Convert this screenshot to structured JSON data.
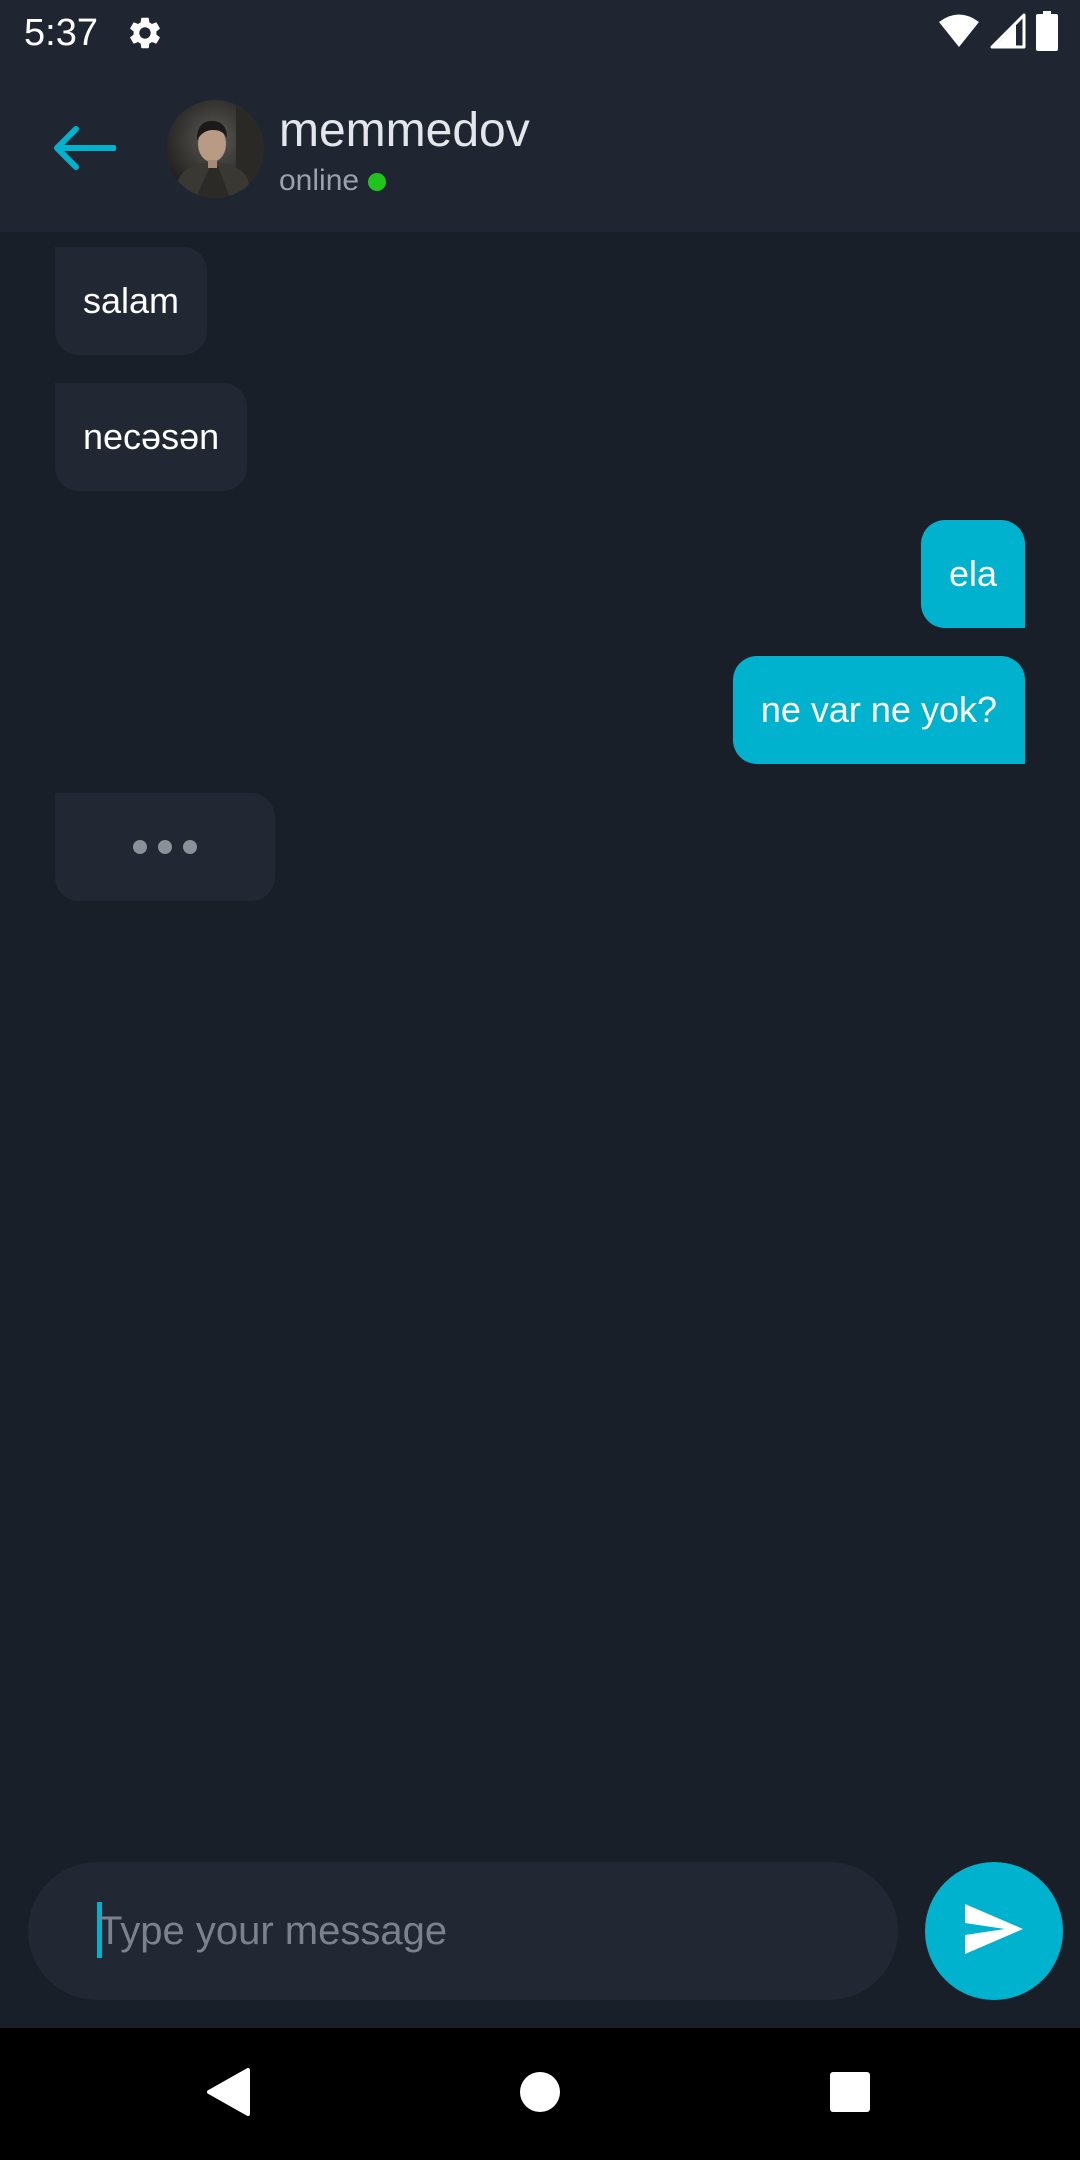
{
  "status_bar": {
    "time": "5:37",
    "icons": [
      "gear-icon",
      "wifi-icon",
      "signal-icon",
      "battery-icon"
    ]
  },
  "header": {
    "back_icon": "arrow-left-icon",
    "contact_name": "memmedov",
    "presence": "online",
    "presence_color": "#22c31c"
  },
  "messages": [
    {
      "direction": "incoming",
      "text": "salam"
    },
    {
      "direction": "incoming",
      "text": "necəsən"
    },
    {
      "direction": "outgoing",
      "text": "ela"
    },
    {
      "direction": "outgoing",
      "text": "ne var ne yok?"
    }
  ],
  "typing_indicator": {
    "icon": "typing-dots-icon"
  },
  "composer": {
    "placeholder": "Type your message",
    "value": "",
    "send_icon": "send-icon"
  },
  "colors": {
    "accent": "#00b2cd",
    "background": "#191f29",
    "header_background": "#202631",
    "incoming_bubble": "#222833"
  },
  "nav_bar": {
    "items": [
      "back-triangle-icon",
      "home-circle-icon",
      "recents-square-icon"
    ]
  }
}
